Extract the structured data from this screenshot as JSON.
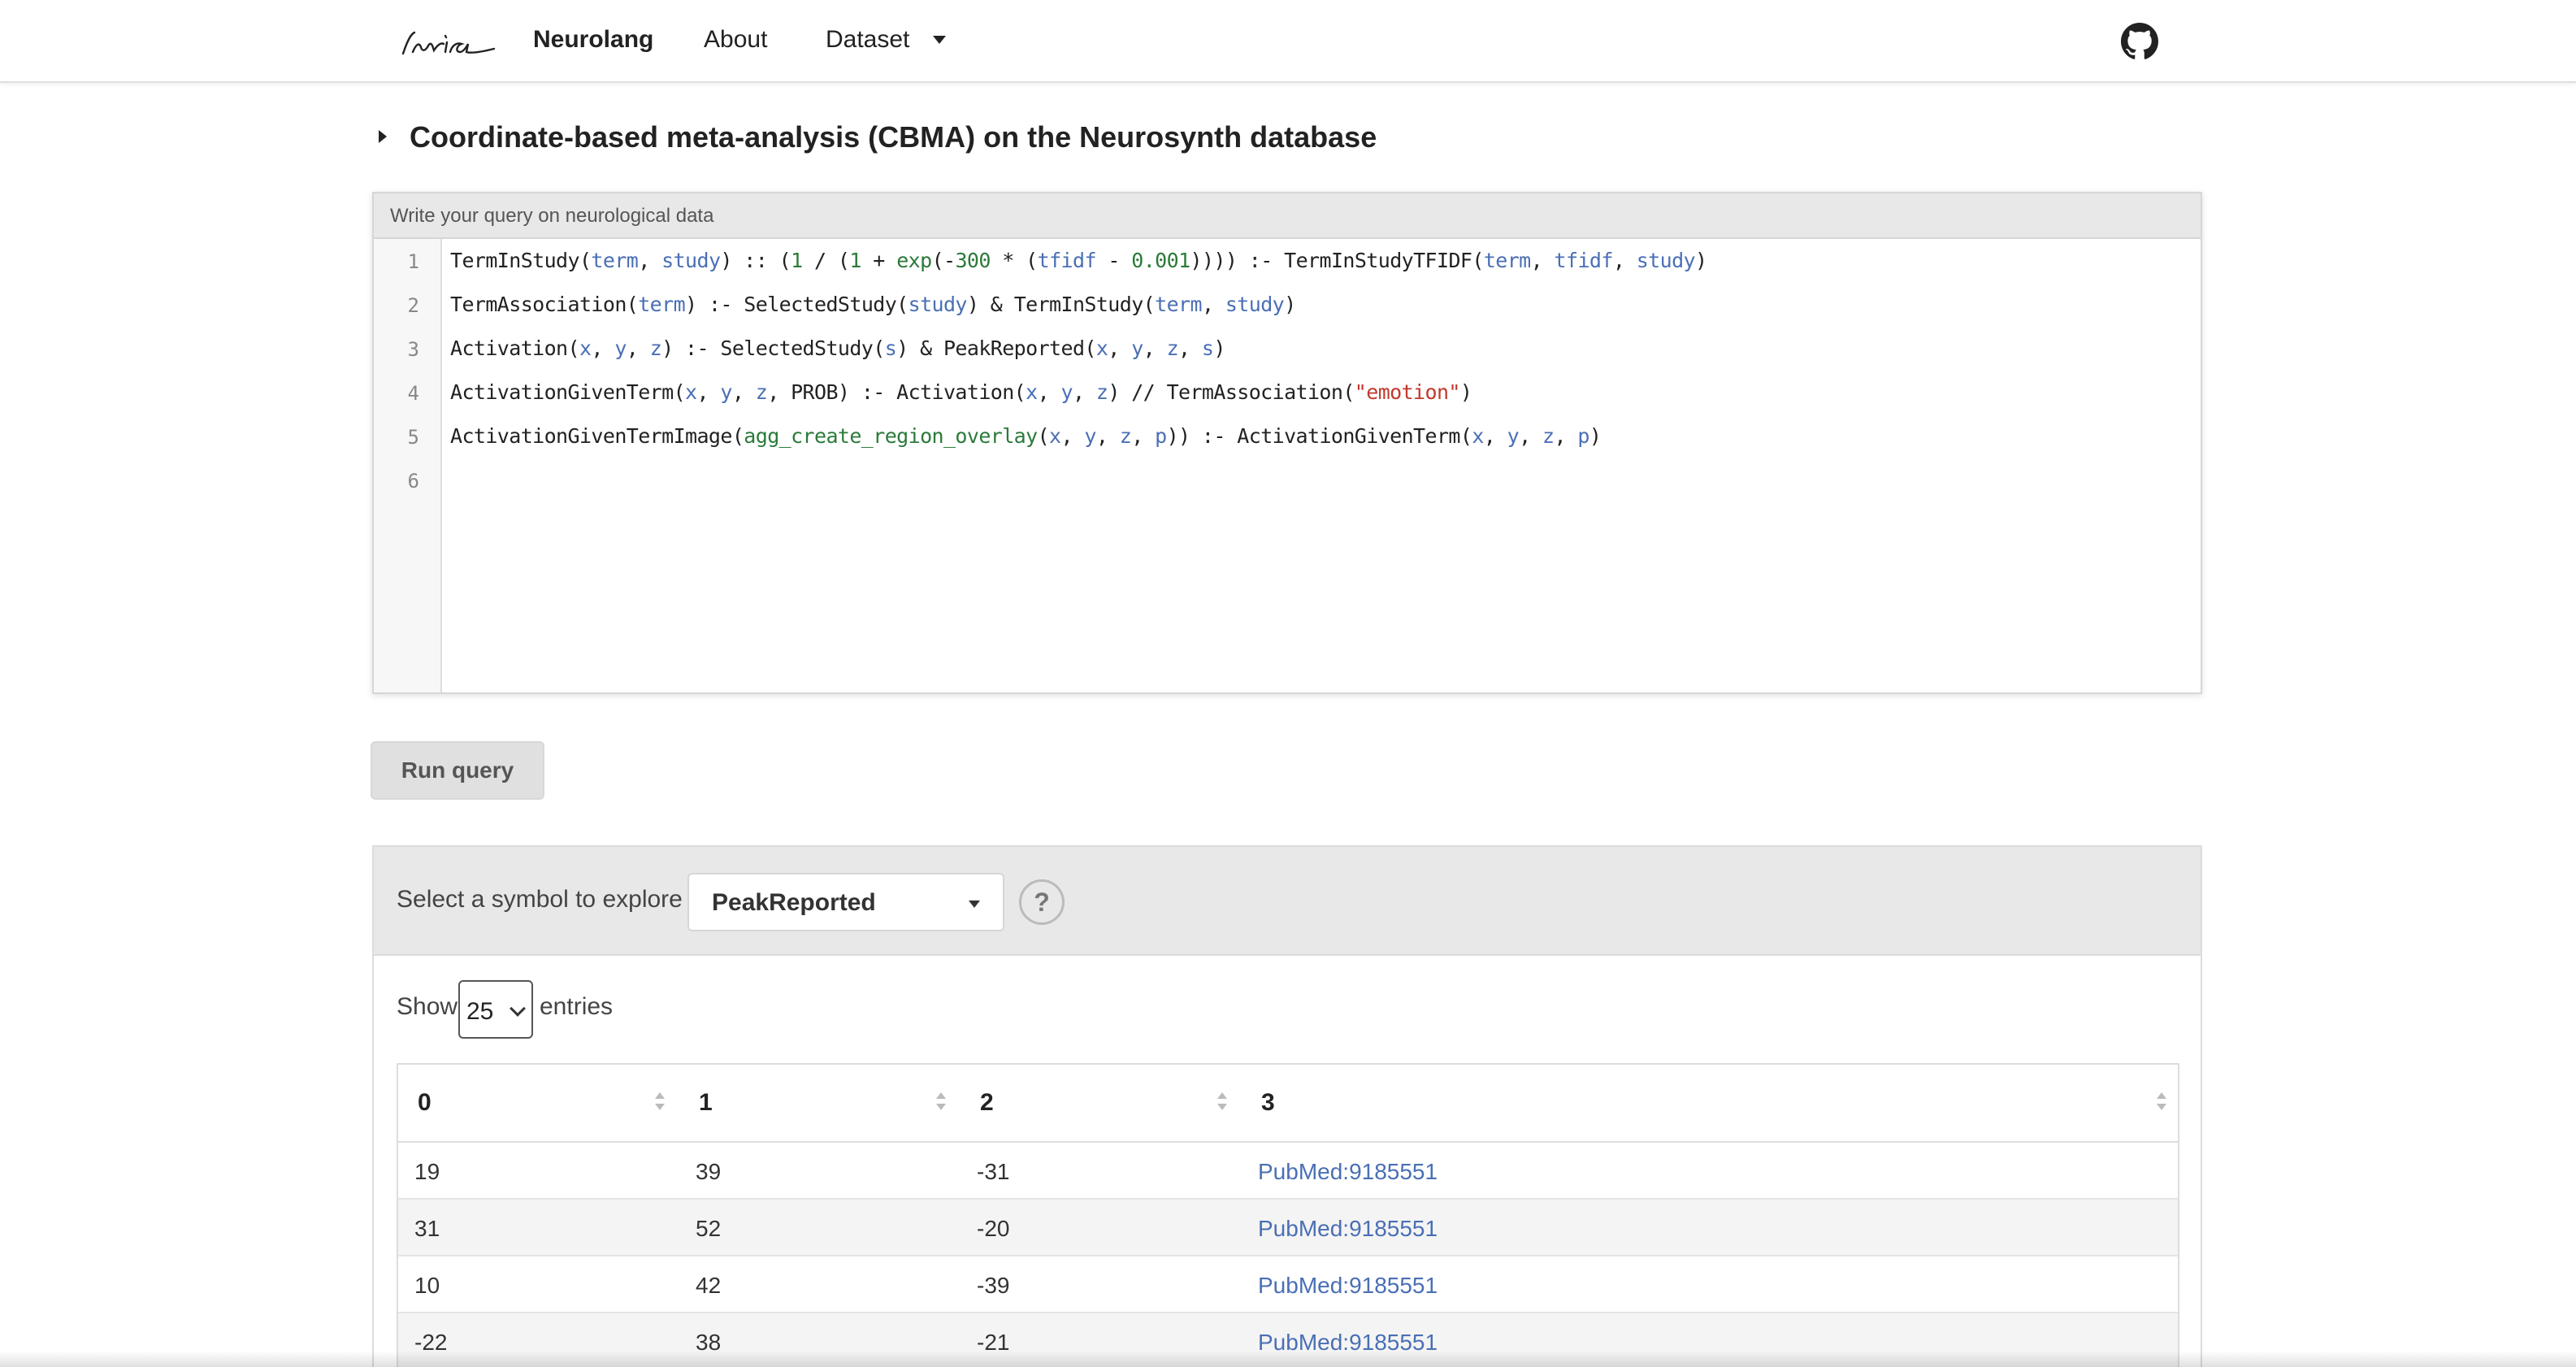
{
  "navbar": {
    "logo_text": "Inria",
    "brand": "Neurolang",
    "about": "About",
    "dataset": "Dataset",
    "github_icon": "github-icon"
  },
  "section": {
    "title": "Coordinate-based meta-analysis (CBMA) on the Neurosynth database"
  },
  "editor": {
    "header": "Write your query on neurological data",
    "line_numbers": [
      "1",
      "2",
      "3",
      "4",
      "5",
      "6"
    ],
    "lines": [
      "TermInStudy(term, study) :: (1 / (1 + exp(-300 * (tfidf - 0.001)))) :- TermInStudyTFIDF(term, tfidf, study)",
      "TermAssociation(term) :- SelectedStudy(study) & TermInStudy(term, study)",
      "Activation(x, y, z) :- SelectedStudy(s) & PeakReported(x, y, z, s)",
      "ActivationGivenTerm(x, y, z, PROB) :- Activation(x, y, z) // TermAssociation(\"emotion\")",
      "ActivationGivenTermImage(agg_create_region_overlay(x, y, z, p)) :- ActivationGivenTerm(x, y, z, p)",
      ""
    ]
  },
  "run_button": "Run query",
  "explorer": {
    "select_label": "Select a symbol to explore",
    "selected_symbol": "PeakReported",
    "help": "?",
    "show": "Show",
    "page_size": "25",
    "entries": "entries"
  },
  "table": {
    "columns": [
      "0",
      "1",
      "2",
      "3"
    ],
    "rows": [
      [
        "19",
        "39",
        "-31",
        "PubMed:9185551"
      ],
      [
        "31",
        "52",
        "-20",
        "PubMed:9185551"
      ],
      [
        "10",
        "42",
        "-39",
        "PubMed:9185551"
      ],
      [
        "-22",
        "38",
        "-21",
        "PubMed:9185551"
      ]
    ]
  }
}
